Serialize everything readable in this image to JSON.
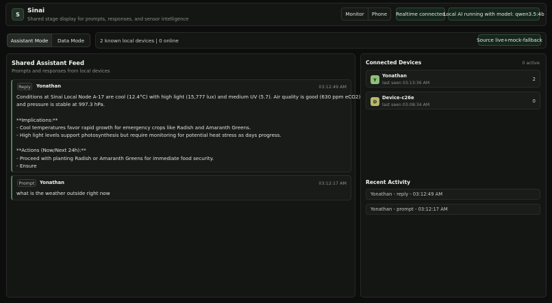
{
  "app": {
    "logo_letter": "S",
    "title": "Sinai",
    "subtitle": "Shared stage display for prompts, responses, and sensor intelligence"
  },
  "header": {
    "view_toggle": [
      "Monitor",
      "Phone"
    ],
    "realtime_status": "Realtime connected",
    "ai_status": "Local AI running with model: qwen3.5:4b"
  },
  "toolbar": {
    "modes": [
      "Assistant Mode",
      "Data Mode"
    ],
    "device_summary": "2 known local devices | 0 online",
    "source_label": "Source live+mock-fallback"
  },
  "feed": {
    "title": "Shared Assistant Feed",
    "subtitle": "Prompts and responses from local devices",
    "entries": [
      {
        "type": "Reply",
        "user": "Yonathan",
        "time": "03:12:49 AM",
        "lines": [
          "Conditions at Sinai Local Node A-17 are cool (12.4°C) with high light (15,777 lux) and medium UV (5.7). Air quality is good (630 ppm eCO2),",
          "and pressure is stable at 997.3 hPa.",
          "",
          "**Implications:**",
          "- Cool temperatures favor rapid growth for emergency crops like Radish and Amaranth Greens.",
          "- High light levels support photosynthesis but require monitoring for potential heat stress as days progress.",
          "",
          "**Actions (Now/Next 24h):**",
          "- Proceed with planting Radish or Amaranth Greens for immediate food security.",
          "- Ensure"
        ]
      },
      {
        "type": "Prompt",
        "user": "Yonathan",
        "time": "03:12:17 AM",
        "lines": [
          "what is the weather outside right now"
        ]
      }
    ]
  },
  "devices": {
    "title": "Connected Devices",
    "active_count": "0 active",
    "items": [
      {
        "initial": "Y",
        "name": "Yonathan",
        "last_seen": "last seen 03:13:36 AM",
        "count": "2",
        "color": "#8fbf7a"
      },
      {
        "initial": "D",
        "name": "Device-c26e",
        "last_seen": "last seen 03:08:34 AM",
        "count": "0",
        "color": "#b9b86a"
      }
    ]
  },
  "activity": {
    "title": "Recent Activity",
    "items": [
      "Yonathan - reply - 03:12:49 AM",
      "Yonathan - prompt - 03:12:17 AM"
    ]
  }
}
